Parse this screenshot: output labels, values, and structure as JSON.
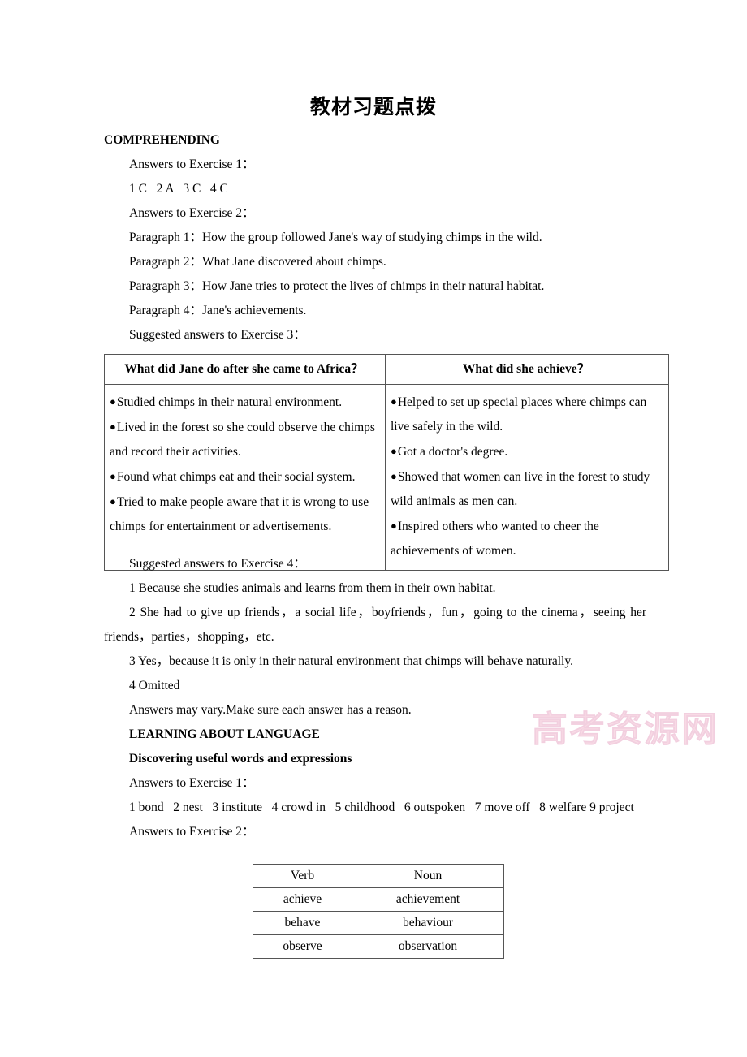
{
  "document": {
    "title": "教材习题点拨"
  },
  "watermark": {
    "text": "高考资源网"
  },
  "section1": {
    "heading": "COMPREHENDING",
    "ex1_label": "Answers to Exercise 1：",
    "ex1_answers": "1 C   2 A   3 C   4 C",
    "ex2_label": "Answers to Exercise 2：",
    "paragraphs": [
      "Paragraph 1：How the group followed Jane's way of studying chimps in the wild.",
      "Paragraph 2：What Jane discovered about chimps.",
      "Paragraph 3：How Jane tries to protect the lives of chimps in their natural habitat.",
      "Paragraph 4：Jane's achievements."
    ],
    "ex3_label": "Suggested answers to Exercise 3："
  },
  "table_ex3": {
    "headers": [
      "What did Jane do after she came to Africa？",
      "What did she achieve？"
    ],
    "col_left": [
      "Studied chimps in their natural environment.",
      "Lived in the forest so she could observe the chimps and record their activities.",
      "Found what chimps eat and their social system.",
      "Tried to make people aware that it is wrong to use chimps for entertainment or advertisements."
    ],
    "col_right": [
      "Helped to set up special places where chimps can live safely in the wild.",
      "Got a doctor's degree.",
      "Showed that women can live in the forest to study wild animals as men can.",
      "Inspired others who wanted to cheer the achievements of women."
    ],
    "bullet_glyph": "●"
  },
  "section2": {
    "ex4_label": "Suggested answers to Exercise 4：",
    "answers": [
      "1 Because she studies animals and learns from them in their own habitat.",
      "2 She had to give up friends，a social life，boyfriends，fun，going to the cinema，seeing her friends，parties，shopping，etc.",
      "3 Yes，because it is only in their natural environment that chimps will behave naturally.",
      "4 Omitted"
    ],
    "note": "Answers may vary.Make sure each answer has a reason."
  },
  "section3": {
    "heading": "LEARNING ABOUT LANGUAGE",
    "subheading": "Discovering useful words and expressions",
    "ex1_label": "Answers to Exercise 1：",
    "ex1_answers": "1 bond   2 nest   3 institute   4 crowd in   5 childhood   6 outspoken   7 move off   8 welfare 9 project",
    "ex2_label": "Answers to Exercise 2："
  },
  "table_vn": {
    "headers": [
      "Verb",
      "Noun"
    ],
    "rows": [
      [
        "achieve",
        "achievement"
      ],
      [
        "behave",
        "behaviour"
      ],
      [
        "observe",
        "observation"
      ]
    ]
  }
}
